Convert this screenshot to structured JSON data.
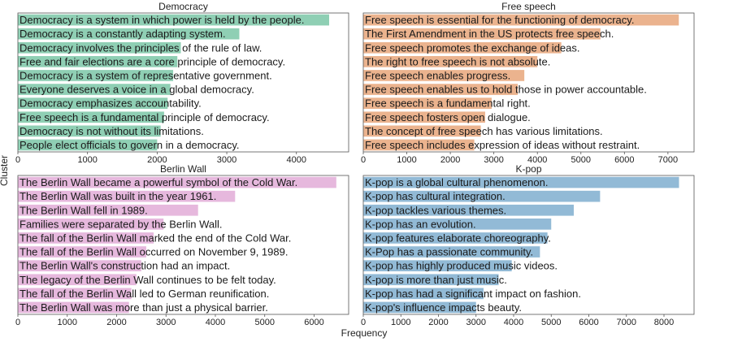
{
  "axes": {
    "xlabel": "Frequency",
    "ylabel": "Cluster"
  },
  "chart_data": [
    {
      "type": "bar",
      "orientation": "horizontal",
      "title": "Democracy",
      "color": "#8fcfb4",
      "xlim": [
        0,
        4750
      ],
      "xticks": [
        0,
        1000,
        2000,
        3000,
        4000
      ],
      "categories": [
        "Democracy is a system in which power is held by the people.",
        "Democracy is a constantly adapting system.",
        "Democracy involves the principles of the rule of law.",
        "Free and fair elections are a core principle of democracy.",
        "Democracy is a system of representative government.",
        "Everyone deserves a voice in a global democracy.",
        "Democracy emphasizes accountability.",
        "Free speech is a fundamental principle of democracy.",
        "Democracy is not without its limitations.",
        "People elect officials to govern in a democracy."
      ],
      "values": [
        4470,
        3180,
        2340,
        2290,
        2230,
        2190,
        2150,
        2100,
        2050,
        2000
      ]
    },
    {
      "type": "bar",
      "orientation": "horizontal",
      "title": "Free speech",
      "color": "#ebb38e",
      "xlim": [
        0,
        7600
      ],
      "xticks": [
        0,
        1000,
        2000,
        3000,
        4000,
        5000,
        6000,
        7000
      ],
      "categories": [
        "Free speech is essential for the functioning of democracy.",
        "The First Amendment in the US protects free speech.",
        "Free speech promotes the exchange of ideas.",
        "The right to free speech is not absolute.",
        "Free speech enables progress.",
        "Free speech enables us to hold those in power accountable.",
        "Free speech is a fundamental right.",
        "Free speech fosters open dialogue.",
        "The concept of free speech has various limitations.",
        "Free speech includes expression of ideas without restraint."
      ],
      "values": [
        7250,
        5450,
        4550,
        4000,
        3700,
        3550,
        2950,
        2800,
        2700,
        2550
      ]
    },
    {
      "type": "bar",
      "orientation": "horizontal",
      "title": "Berlin Wall",
      "color": "#e6b8dd",
      "xlim": [
        0,
        6700
      ],
      "xticks": [
        0,
        1000,
        2000,
        3000,
        4000,
        5000,
        6000
      ],
      "categories": [
        "The Berlin Wall became a powerful symbol of the Cold War.",
        "The Berlin Wall was built in the year 1961.",
        "The Berlin Wall fell in 1989.",
        "Families were separated by the Berlin Wall.",
        "The fall of the Berlin Wall marked the end of the Cold War.",
        "The fall of the Berlin Wall occurred on November 9, 1989.",
        "The Berlin Wall's construction had an impact.",
        "The legacy of the Berlin Wall continues to be felt today.",
        "The fall of the Berlin Wall led to German reunification.",
        "The Berlin Wall was more than just a physical barrier."
      ],
      "values": [
        6450,
        4400,
        3650,
        2950,
        2750,
        2600,
        2500,
        2400,
        2300,
        2250
      ]
    },
    {
      "type": "bar",
      "orientation": "horizontal",
      "title": "K-pop",
      "color": "#92bad6",
      "xlim": [
        0,
        8800
      ],
      "xticks": [
        0,
        1000,
        2000,
        3000,
        4000,
        5000,
        6000,
        7000,
        8000
      ],
      "categories": [
        "K-pop is a global cultural phenomenon.",
        "K-pop has cultural integration.",
        "K-pop tackles various themes.",
        "K-pop has an evolution.",
        "K-pop features elaborate choreography.",
        "K-Pop has a passionate community.",
        "K-pop has highly produced music videos.",
        "K-pop is more than just music.",
        "K-pop has had a significant impact on fashion.",
        "K-pop's influence impacts beauty."
      ],
      "values": [
        8400,
        6300,
        5600,
        5000,
        4900,
        4700,
        3950,
        3600,
        3200,
        3000
      ]
    }
  ]
}
